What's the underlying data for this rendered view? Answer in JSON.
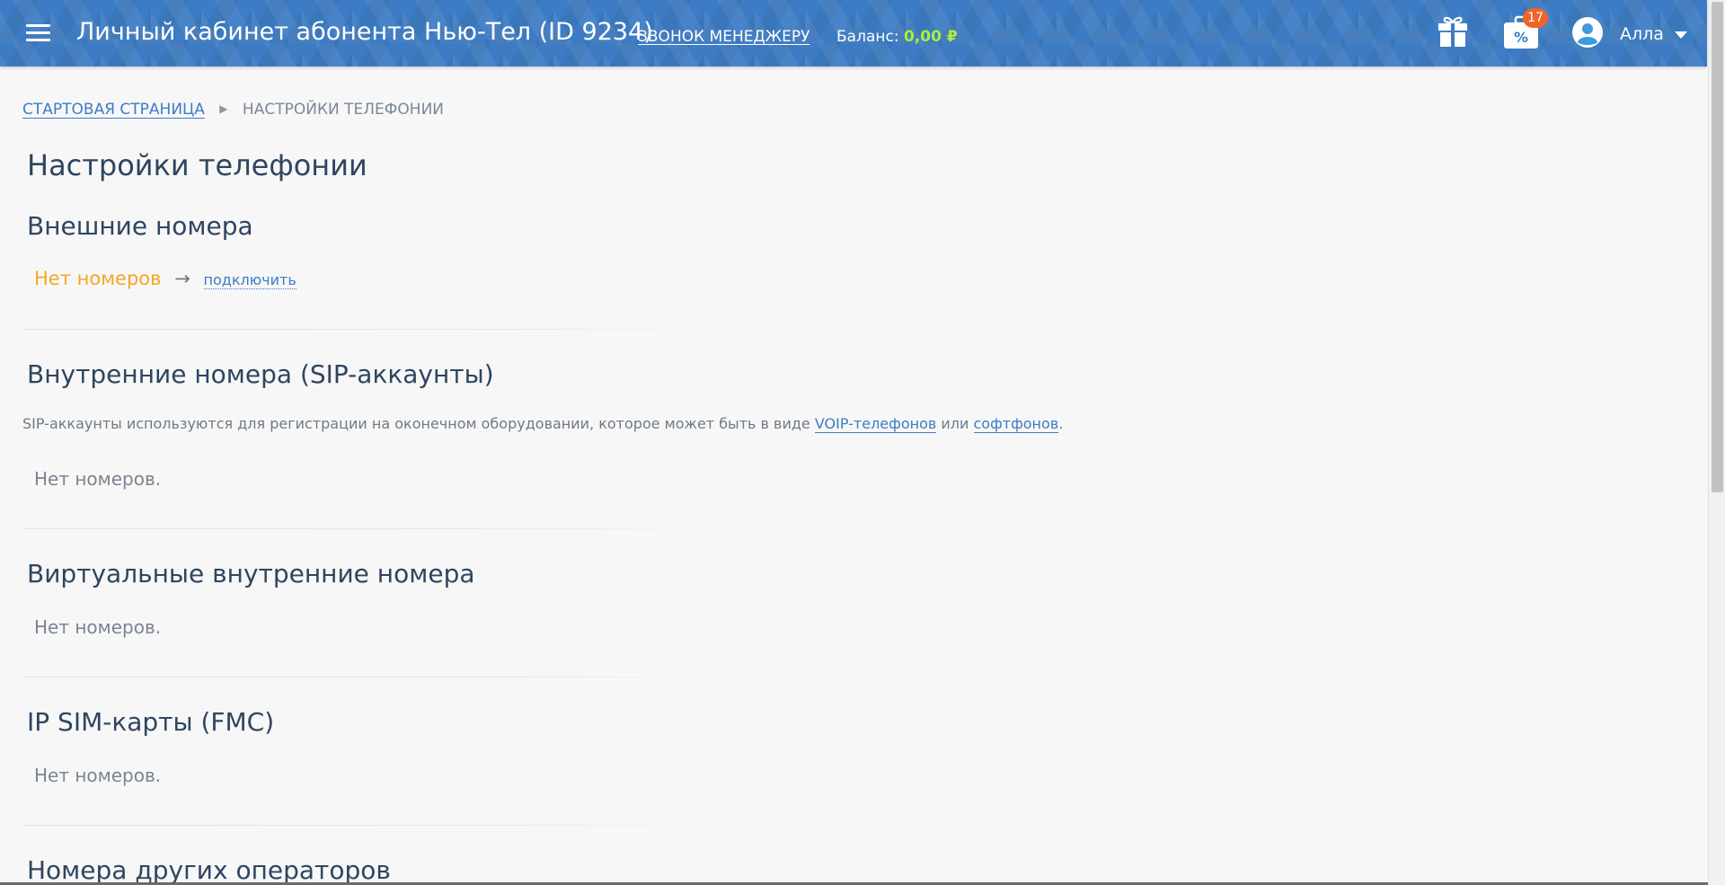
{
  "header": {
    "app_title": "Личный кабинет абонента Нью-Тел (ID 9234)",
    "call_manager": "ЗВОНОК МЕНЕДЖЕРУ",
    "balance_label": "Баланс:",
    "balance_value": "0,00 ₽",
    "promo_icon_text": "%",
    "promo_badge": "17",
    "user_name": "Алла",
    "colors": {
      "bar": "#3d7cc4",
      "balance": "#a9ef3c",
      "badge": "#f0642c"
    }
  },
  "breadcrumb": {
    "home": "СТАРТОВАЯ СТРАНИЦА",
    "current": "НАСТРОЙКИ ТЕЛЕФОНИИ"
  },
  "page": {
    "title": "Настройки телефонии"
  },
  "sections": {
    "external": {
      "title": "Внешние номера",
      "empty": "Нет номеров",
      "arrow": "→",
      "connect": "подключить"
    },
    "sip": {
      "title": "Внутренние номера (SIP-аккаунты)",
      "desc_prefix": "SIP-аккаунты используются для регистрации на оконечном оборудовании, которое может быть в виде ",
      "desc_link1": "VOIP-телефонов",
      "desc_middle": " или ",
      "desc_link2": "софтфонов",
      "desc_suffix": ".",
      "empty": "Нет номеров."
    },
    "virtual": {
      "title": "Виртуальные внутренние номера",
      "empty": "Нет номеров."
    },
    "ipsim": {
      "title": "IP SIM-карты (FMC)",
      "empty": "Нет номеров."
    },
    "other": {
      "title": "Номера других операторов"
    }
  }
}
